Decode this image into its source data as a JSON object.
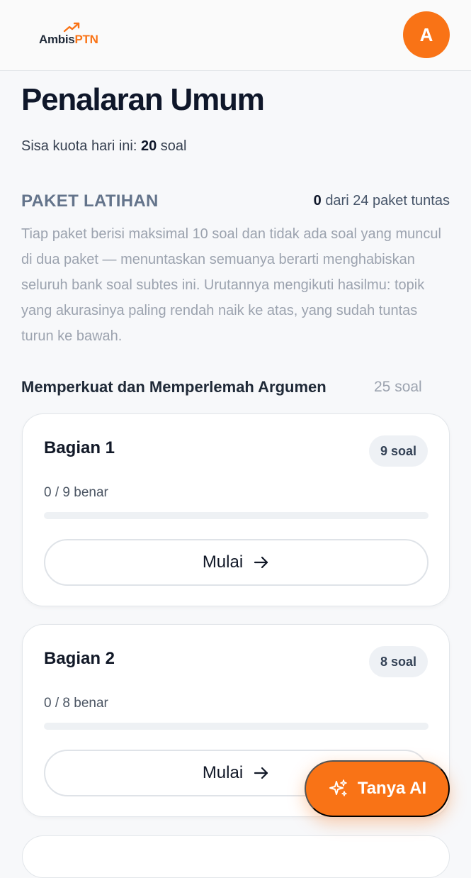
{
  "header": {
    "logo_part1": "Ambis",
    "logo_part2": "PTN",
    "avatar_initial": "A"
  },
  "page": {
    "title": "Penalaran Umum",
    "quota_prefix": "Sisa kuota hari ini:",
    "quota_value": "20",
    "quota_suffix": "soal"
  },
  "section": {
    "title": "PAKET LATIHAN",
    "done_count": "0",
    "done_suffix": "dari 24 paket tuntas",
    "description": "Tiap paket berisi maksimal 10 soal dan tidak ada soal yang muncul di dua paket — menuntaskan semuanya berarti menghabiskan seluruh bank soal subtes ini. Urutannya mengikuti hasilmu: topik yang akurasinya paling rendah naik ke atas, yang sudah tuntas turun ke bawah."
  },
  "topic": {
    "title": "Memperkuat dan Memperlemah Argumen",
    "count": "25 soal"
  },
  "cards": [
    {
      "title": "Bagian 1",
      "badge": "9 soal",
      "score": "0 / 9 benar",
      "progress": 0,
      "button": "Mulai"
    },
    {
      "title": "Bagian 2",
      "badge": "8 soal",
      "score": "0 / 8 benar",
      "progress": 0,
      "button": "Mulai"
    }
  ],
  "fab": {
    "label": "Tanya AI"
  },
  "colors": {
    "accent": "#f97316",
    "background": "#f7f8fa"
  },
  "icons": {
    "logo": "trend-arrow-icon",
    "button": "arrow-right-icon",
    "fab": "sparkles-icon"
  }
}
